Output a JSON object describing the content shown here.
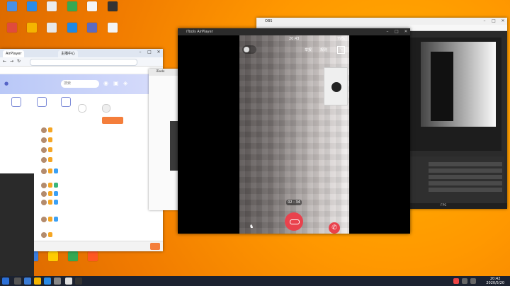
{
  "desktop_icons": [
    "",
    "",
    "",
    "",
    "",
    "",
    "",
    "",
    "",
    "",
    "",
    "",
    "",
    "",
    ""
  ],
  "browser": {
    "tabs": [
      "AirPlayer",
      "主播中心"
    ],
    "search_placeholder": "搜索",
    "bookmarks": [
      "",
      "",
      "",
      "",
      "",
      "",
      "",
      "",
      ""
    ],
    "nav_items": [
      "",
      "",
      "",
      ""
    ],
    "nav_buttons": [
      "",
      ""
    ],
    "list_rows": [
      "",
      "",
      "",
      "",
      "",
      "",
      "",
      "",
      "",
      "",
      "",
      "",
      "",
      ""
    ],
    "bottom_text": ""
  },
  "mid_window": {
    "title": "iTools"
  },
  "obs": {
    "title": "OBS",
    "controls": [
      "",
      "",
      "",
      "",
      ""
    ],
    "status": "FPS"
  },
  "airplayer": {
    "title": "iTools AirPlayer",
    "status_time": "20:43",
    "battery": "79%",
    "user_label": "",
    "call_timer": "02 : 34",
    "tabs": [
      "举报",
      "规则"
    ]
  },
  "taskbar": {
    "time": "20:42",
    "date": "2020/5/20"
  }
}
